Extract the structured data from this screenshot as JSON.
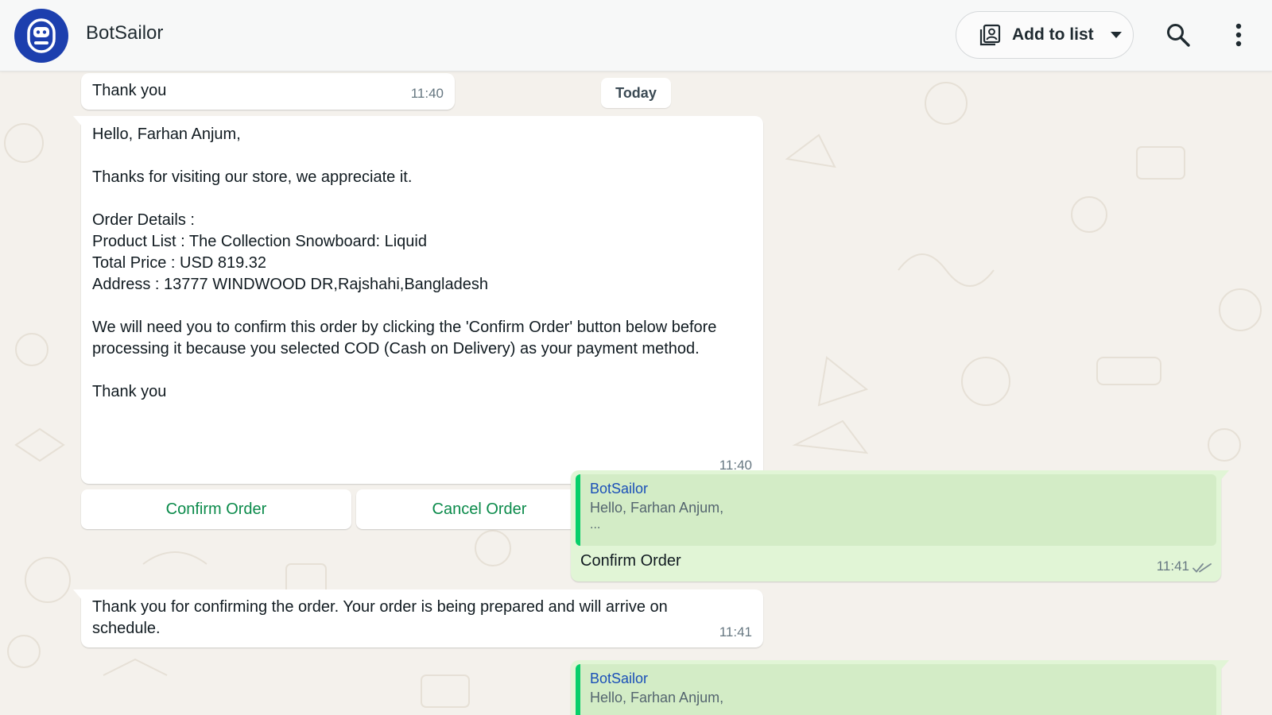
{
  "header": {
    "contact_name": "BotSailor",
    "add_to_list_label": "Add to list"
  },
  "chat": {
    "date_chip": "Today",
    "messages": [
      {
        "direction": "incoming",
        "text": "Thank you",
        "time": "11:40"
      },
      {
        "direction": "incoming",
        "lines": [
          "Hello, Farhan Anjum,",
          "Thanks for visiting our store, we appreciate it.",
          "Order Details :",
          "Product List : The Collection Snowboard: Liquid",
          "Total Price : USD 819.32",
          "Address : 13777 WINDWOOD DR,Rajshahi,Bangladesh",
          "We will need you to confirm this order by clicking the 'Confirm Order' button below before",
          "processing it because you selected COD (Cash on Delivery) as your payment method.",
          "Thank you"
        ],
        "time": "11:40",
        "buttons": [
          "Confirm Order",
          "Cancel Order"
        ]
      },
      {
        "direction": "outgoing",
        "quote": {
          "author": "BotSailor",
          "text": "Hello, Farhan Anjum,",
          "more": "..."
        },
        "text": "Confirm Order",
        "time": "11:41",
        "status": "read"
      },
      {
        "direction": "incoming",
        "lines": [
          "Thank you for confirming the order. Your order is being prepared and will arrive on",
          "schedule."
        ],
        "time": "11:41"
      },
      {
        "direction": "outgoing",
        "quote": {
          "author": "BotSailor",
          "text": "Hello, Farhan Anjum,"
        }
      }
    ]
  },
  "colors": {
    "header_bg": "#f7f8f8",
    "chat_bg": "#f4f1ec",
    "incoming_bubble": "#ffffff",
    "outgoing_bubble": "#e1f5d6",
    "quote_bar": "#06cf6a",
    "quote_author": "#1a4fb8",
    "button_text": "#0a8a4a",
    "avatar_bg": "#1c3fae"
  },
  "icons": [
    "bot-avatar-icon",
    "contact-list-icon",
    "caret-down-icon",
    "search-icon",
    "more-vertical-icon",
    "double-check-icon"
  ]
}
